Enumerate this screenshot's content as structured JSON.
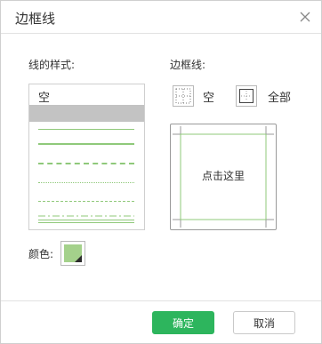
{
  "dialog": {
    "title": "边框线",
    "close_icon": "close-icon"
  },
  "style_section": {
    "label": "线的样式:",
    "items": [
      {
        "kind": "text",
        "label": "空"
      },
      {
        "kind": "selected",
        "label": ""
      },
      {
        "kind": "solid-thin"
      },
      {
        "kind": "solid-medium"
      },
      {
        "kind": "dashed-heavy"
      },
      {
        "kind": "dotted"
      },
      {
        "kind": "dashed"
      },
      {
        "kind": "dash-dot"
      },
      {
        "kind": "double"
      }
    ]
  },
  "border_section": {
    "label": "边框线:",
    "options": [
      {
        "label": "空",
        "icon": "border-none-icon"
      },
      {
        "label": "全部",
        "icon": "border-all-icon"
      }
    ],
    "preview_text": "点击这里"
  },
  "color_section": {
    "label": "颜色:",
    "value": "#a4d18b"
  },
  "footer": {
    "ok_label": "确定",
    "cancel_label": "取消"
  },
  "colors": {
    "accent": "#2db55d",
    "line_green": "#8fc97a",
    "selection": "#c3c3c3"
  }
}
